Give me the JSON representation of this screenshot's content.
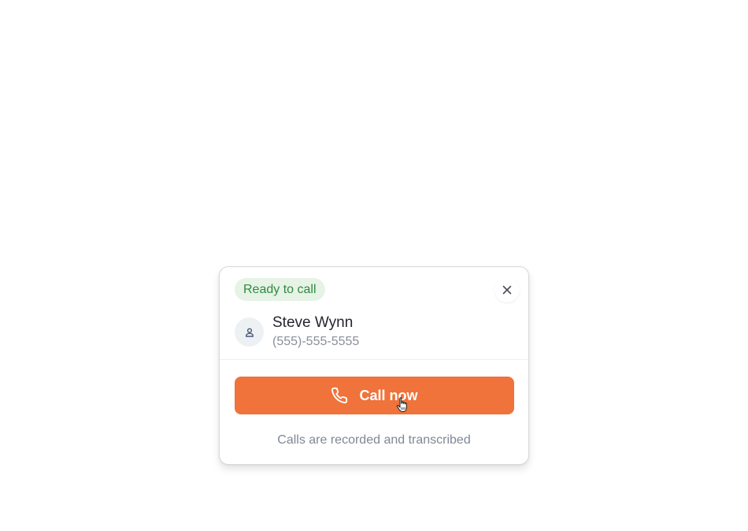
{
  "call_card": {
    "status": {
      "label": "Ready to call",
      "color": "#2f8a3e",
      "background": "#e6f3e6"
    },
    "close_icon": "close-icon",
    "contact": {
      "avatar_icon": "person-icon",
      "name": "Steve Wynn",
      "phone": "(555)-555-5555"
    },
    "call_button": {
      "label": "Call now",
      "icon": "phone-icon",
      "color": "#ef733a"
    },
    "footer_note": "Calls are recorded and transcribed"
  }
}
